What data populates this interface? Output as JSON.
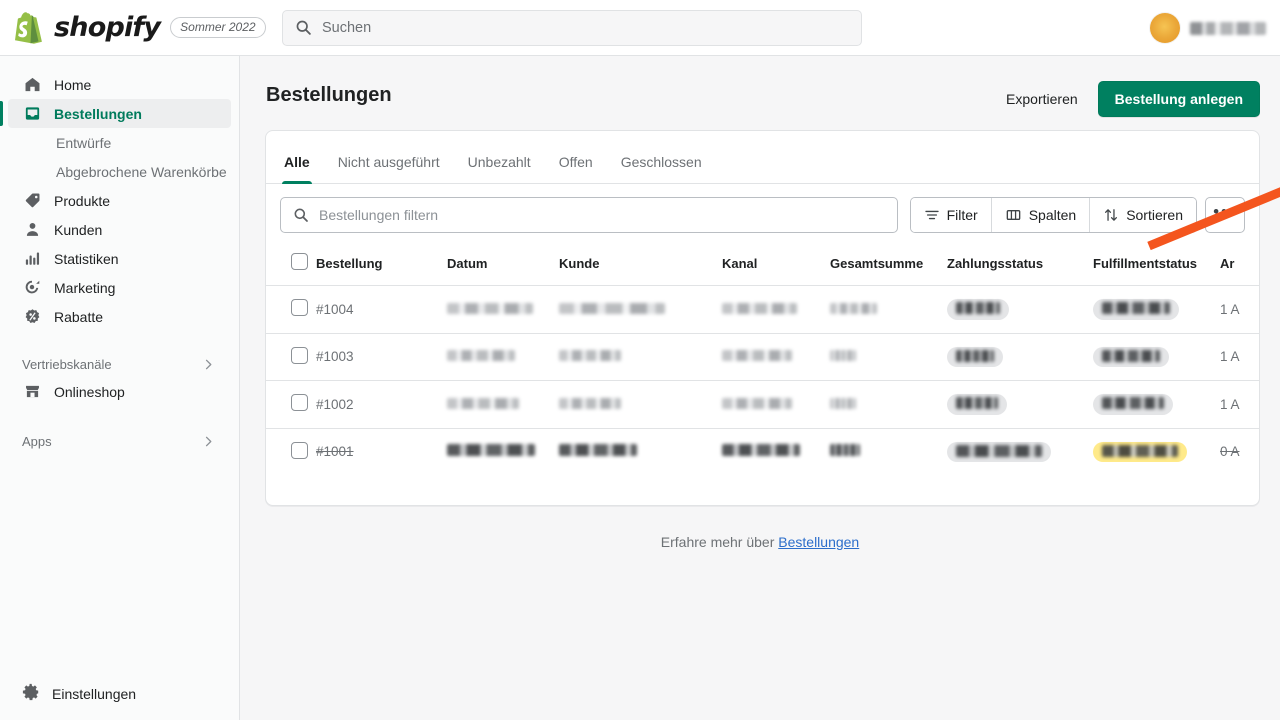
{
  "topbar": {
    "brand_name": "shopify",
    "season_badge": "Sommer 2022",
    "search_placeholder": "Suchen",
    "search_value": "",
    "logo_icon": "shopify-bag-icon",
    "search_icon": "search-icon",
    "avatar_icon": "avatar",
    "user_name_redacted": ""
  },
  "sidebar": {
    "items": [
      {
        "label": "Home",
        "icon": "home-icon",
        "active": false
      },
      {
        "label": "Bestellungen",
        "icon": "orders-inbox-icon",
        "active": true
      },
      {
        "label": "Produkte",
        "icon": "tag-icon",
        "active": false
      },
      {
        "label": "Kunden",
        "icon": "person-icon",
        "active": false
      },
      {
        "label": "Statistiken",
        "icon": "bar-chart-icon",
        "active": false
      },
      {
        "label": "Marketing",
        "icon": "megaphone-target-icon",
        "active": false
      },
      {
        "label": "Rabatte",
        "icon": "discount-percent-icon",
        "active": false
      }
    ],
    "sub_items": [
      {
        "label": "Entwürfe"
      },
      {
        "label": "Abgebrochene Warenkörbe"
      }
    ],
    "groups": [
      {
        "label": "Vertriebskanäle",
        "icon": "chevron-right-icon"
      },
      {
        "label": "Apps",
        "icon": "chevron-right-icon"
      }
    ],
    "channel_item": {
      "label": "Onlineshop",
      "icon": "storefront-icon"
    },
    "settings": {
      "label": "Einstellungen",
      "icon": "gear-icon"
    }
  },
  "page": {
    "title": "Bestellungen",
    "export_label": "Exportieren",
    "create_label": "Bestellung anlegen",
    "primary_color": "#008060",
    "annotation_arrow_color": "#f4551e"
  },
  "tabs": [
    {
      "label": "Alle",
      "active": true
    },
    {
      "label": "Nicht ausgeführt",
      "active": false
    },
    {
      "label": "Unbezahlt",
      "active": false
    },
    {
      "label": "Offen",
      "active": false
    },
    {
      "label": "Geschlossen",
      "active": false
    }
  ],
  "toolbar": {
    "filter_placeholder": "Bestellungen filtern",
    "filter_value": "",
    "search_icon": "search-icon",
    "buttons": [
      {
        "label": "Filter",
        "icon": "filter-icon"
      },
      {
        "label": "Spalten",
        "icon": "columns-icon"
      },
      {
        "label": "Sortieren",
        "icon": "sort-arrows-icon"
      }
    ],
    "more_label": "•••"
  },
  "table": {
    "select_all_icon": "checkbox-icon",
    "columns": [
      "Bestellung",
      "Datum",
      "Kunde",
      "Kanal",
      "Gesamtsumme",
      "Zahlungsstatus",
      "Fulfillmentstatus",
      "Ar"
    ],
    "rows": [
      {
        "order": "#1004",
        "voided": false,
        "redacted": true,
        "items": "1 A",
        "payment_badge": "gray",
        "fulfillment_badge": "gray"
      },
      {
        "order": "#1003",
        "voided": false,
        "redacted": true,
        "items": "1 A",
        "payment_badge": "gray",
        "fulfillment_badge": "gray"
      },
      {
        "order": "#1002",
        "voided": false,
        "redacted": true,
        "items": "1 A",
        "payment_badge": "gray",
        "fulfillment_badge": "gray"
      },
      {
        "order": "#1001",
        "voided": true,
        "redacted": true,
        "items": "0 A",
        "payment_badge": "gray",
        "fulfillment_badge": "yellow"
      }
    ]
  },
  "footer": {
    "text": "Erfahre mehr über",
    "link_label": "Bestellungen"
  }
}
